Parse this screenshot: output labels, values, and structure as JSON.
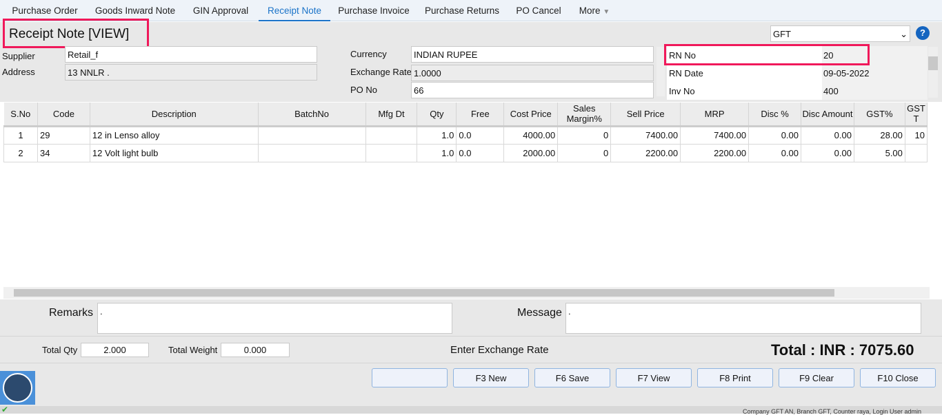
{
  "tabs": [
    "Purchase Order",
    "Goods Inward Note",
    "GIN Approval",
    "Receipt Note",
    "Purchase Invoice",
    "Purchase Returns",
    "PO Cancel",
    "More"
  ],
  "active_tab": "Receipt Note",
  "title": "Receipt Note [VIEW]",
  "branch_select": "GFT",
  "form": {
    "supplier_label": "Supplier",
    "supplier": "Retail_f",
    "address_label": "Address",
    "address": "13 NNLR .",
    "currency_label": "Currency",
    "currency": "INDIAN RUPEE",
    "exchange_rate_label": "Exchange Rate",
    "exchange_rate": "1.0000",
    "po_no_label": "PO No",
    "po_no": "66",
    "rn_no_label": "RN No",
    "rn_no": "20",
    "rn_date_label": "RN Date",
    "rn_date": "09-05-2022",
    "inv_no_label": "Inv No",
    "inv_no": "400"
  },
  "table": {
    "columns": [
      "S.No",
      "Code",
      "Description",
      "BatchNo",
      "Mfg Dt",
      "Qty",
      "Free",
      "Cost Price",
      "Sales Margin%",
      "Sell Price",
      "MRP",
      "Disc %",
      "Disc Amount",
      "GST%",
      "GST T"
    ],
    "rows": [
      [
        "1",
        "29",
        "12 in Lenso alloy",
        "",
        "",
        "1.0",
        "0.0",
        "4000.00",
        "0",
        "7400.00",
        "7400.00",
        "0.00",
        "0.00",
        "28.00",
        "10"
      ],
      [
        "2",
        "34",
        "12 Volt light bulb",
        "",
        "",
        "1.0",
        "0.0",
        "2000.00",
        "0",
        "2200.00",
        "2200.00",
        "0.00",
        "0.00",
        "5.00",
        ""
      ]
    ]
  },
  "remarks_label": "Remarks",
  "remarks": ".",
  "message_label": "Message",
  "message": ".",
  "total_qty_label": "Total Qty",
  "total_qty": "2.000",
  "total_weight_label": "Total Weight",
  "total_weight": "0.000",
  "hint": "Enter Exchange Rate",
  "total": "Total : INR : 7075.60",
  "buttons": [
    "",
    "F3 New",
    "F6 Save",
    "F7 View",
    "F8 Print",
    "F9 Clear",
    "F10 Close"
  ],
  "status_text": "Company GFT AN, Branch GFT, Counter raya, Login User admin",
  "colors": {
    "accent": "#1a73c8",
    "highlight": "#f0185a"
  }
}
